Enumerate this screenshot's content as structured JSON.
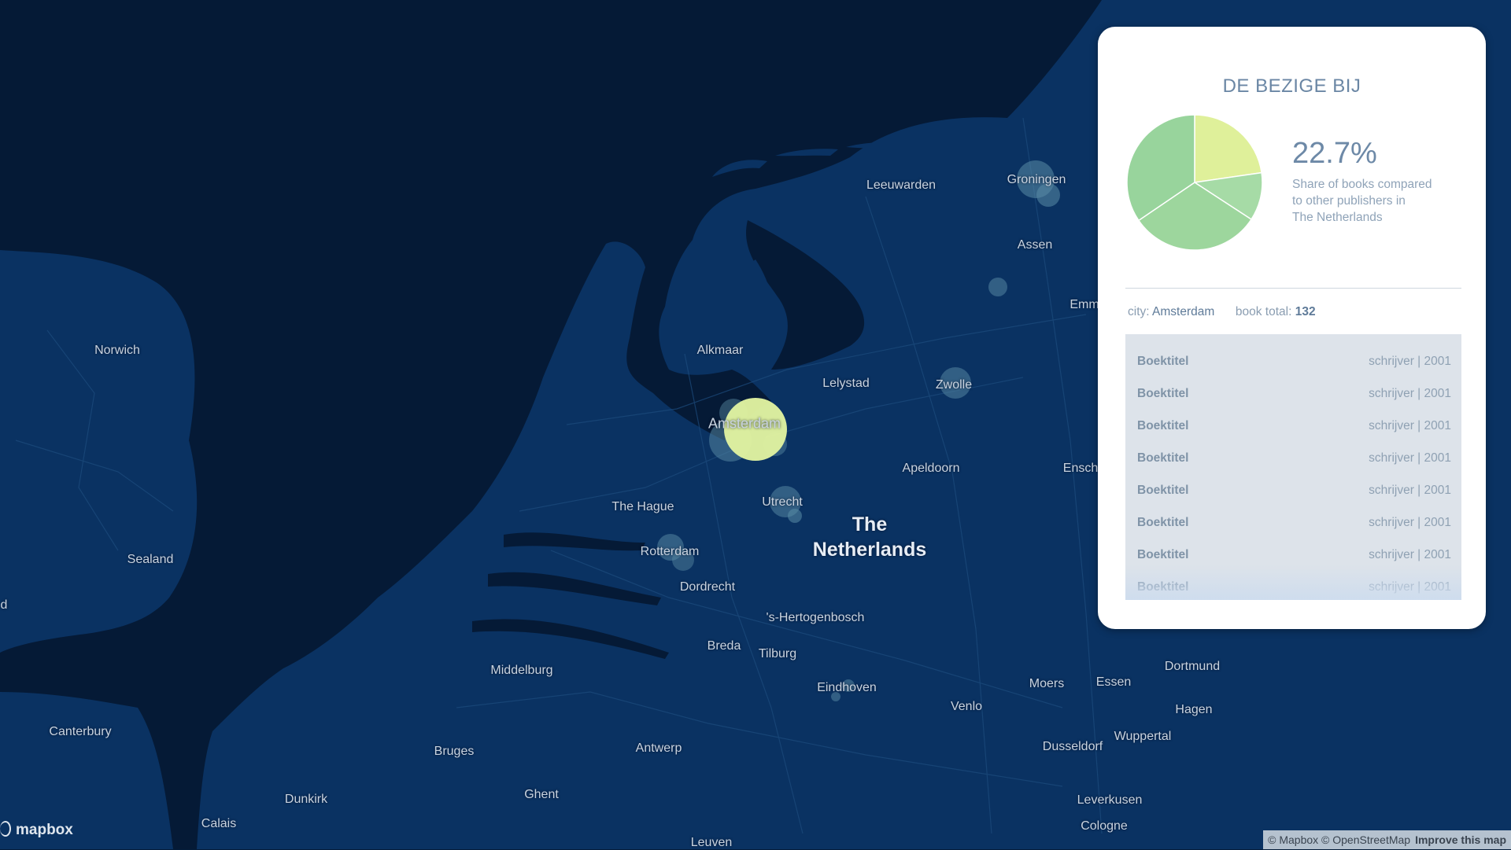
{
  "map": {
    "places": [
      {
        "name": "Leeuwarden",
        "type": "city"
      },
      {
        "name": "Groningen",
        "type": "city"
      },
      {
        "name": "Assen",
        "type": "city"
      },
      {
        "name": "Emm",
        "type": "city"
      },
      {
        "name": "Norwich",
        "type": "city"
      },
      {
        "name": "Alkmaar",
        "type": "city"
      },
      {
        "name": "Lelystad",
        "type": "city"
      },
      {
        "name": "Zwolle",
        "type": "city"
      },
      {
        "name": "Amsterdam",
        "type": "city"
      },
      {
        "name": "Apeldoorn",
        "type": "city"
      },
      {
        "name": "Ensch",
        "type": "city"
      },
      {
        "name": "The Hague",
        "type": "city"
      },
      {
        "name": "Utrecht",
        "type": "city"
      },
      {
        "name": "Sealand",
        "type": "region"
      },
      {
        "name": "Rotterdam",
        "type": "city"
      },
      {
        "name": "Dordrecht",
        "type": "city"
      },
      {
        "name": "'s-Hertogenbosch",
        "type": "city"
      },
      {
        "name": "Breda",
        "type": "city"
      },
      {
        "name": "Tilburg",
        "type": "city"
      },
      {
        "name": "Middelburg",
        "type": "city"
      },
      {
        "name": "Dortmund",
        "type": "city"
      },
      {
        "name": "Eindhoven",
        "type": "city"
      },
      {
        "name": "Moers",
        "type": "city"
      },
      {
        "name": "Essen",
        "type": "city"
      },
      {
        "name": "Venlo",
        "type": "city"
      },
      {
        "name": "Hagen",
        "type": "city"
      },
      {
        "name": "Canterbury",
        "type": "city"
      },
      {
        "name": "Wuppertal",
        "type": "city"
      },
      {
        "name": "Bruges",
        "type": "city"
      },
      {
        "name": "Antwerp",
        "type": "city"
      },
      {
        "name": "Dusseldorf",
        "type": "city"
      },
      {
        "name": "Dunkirk",
        "type": "city"
      },
      {
        "name": "Ghent",
        "type": "city"
      },
      {
        "name": "Leverkusen",
        "type": "city"
      },
      {
        "name": "Calais",
        "type": "city"
      },
      {
        "name": "Cologne",
        "type": "city"
      },
      {
        "name": "Leuven",
        "type": "city"
      },
      {
        "name": "d",
        "type": "city"
      }
    ],
    "country_label": [
      "The",
      "Netherlands"
    ],
    "highlight_color": "#dff09a",
    "bubble_color": "#3f6f8f",
    "bubbles_highlighted_city": "Amsterdam"
  },
  "panel": {
    "title": "DE BEZIGE BIJ",
    "share_value": "22.7%",
    "share_desc_lines": [
      "Share of books compared",
      "to other publishers in",
      "The Netherlands"
    ],
    "city_label": "city:",
    "city_value": "Amsterdam",
    "total_label": "book total:",
    "total_value": "132",
    "books": [
      {
        "title": "Boektitel",
        "meta": "schrijver | 2001"
      },
      {
        "title": "Boektitel",
        "meta": "schrijver | 2001"
      },
      {
        "title": "Boektitel",
        "meta": "schrijver | 2001"
      },
      {
        "title": "Boektitel",
        "meta": "schrijver | 2001"
      },
      {
        "title": "Boektitel",
        "meta": "schrijver | 2001"
      },
      {
        "title": "Boektitel",
        "meta": "schrijver | 2001"
      },
      {
        "title": "Boektitel",
        "meta": "schrijver | 2001"
      },
      {
        "title": "Boektitel",
        "meta": "schrijver | 2001"
      }
    ]
  },
  "chart_data": {
    "type": "pie",
    "title": "",
    "slices": [
      {
        "value": 22.7,
        "color": "#dff09a"
      },
      {
        "value": 11.5,
        "color": "#a6dba6"
      },
      {
        "value": 31.3,
        "color": "#9dd69d"
      },
      {
        "value": 34.5,
        "color": "#98d49c"
      }
    ]
  },
  "footer": {
    "logo_text": "mapbox",
    "attribution": "© Mapbox © OpenStreetMap",
    "improve": "Improve this map"
  }
}
